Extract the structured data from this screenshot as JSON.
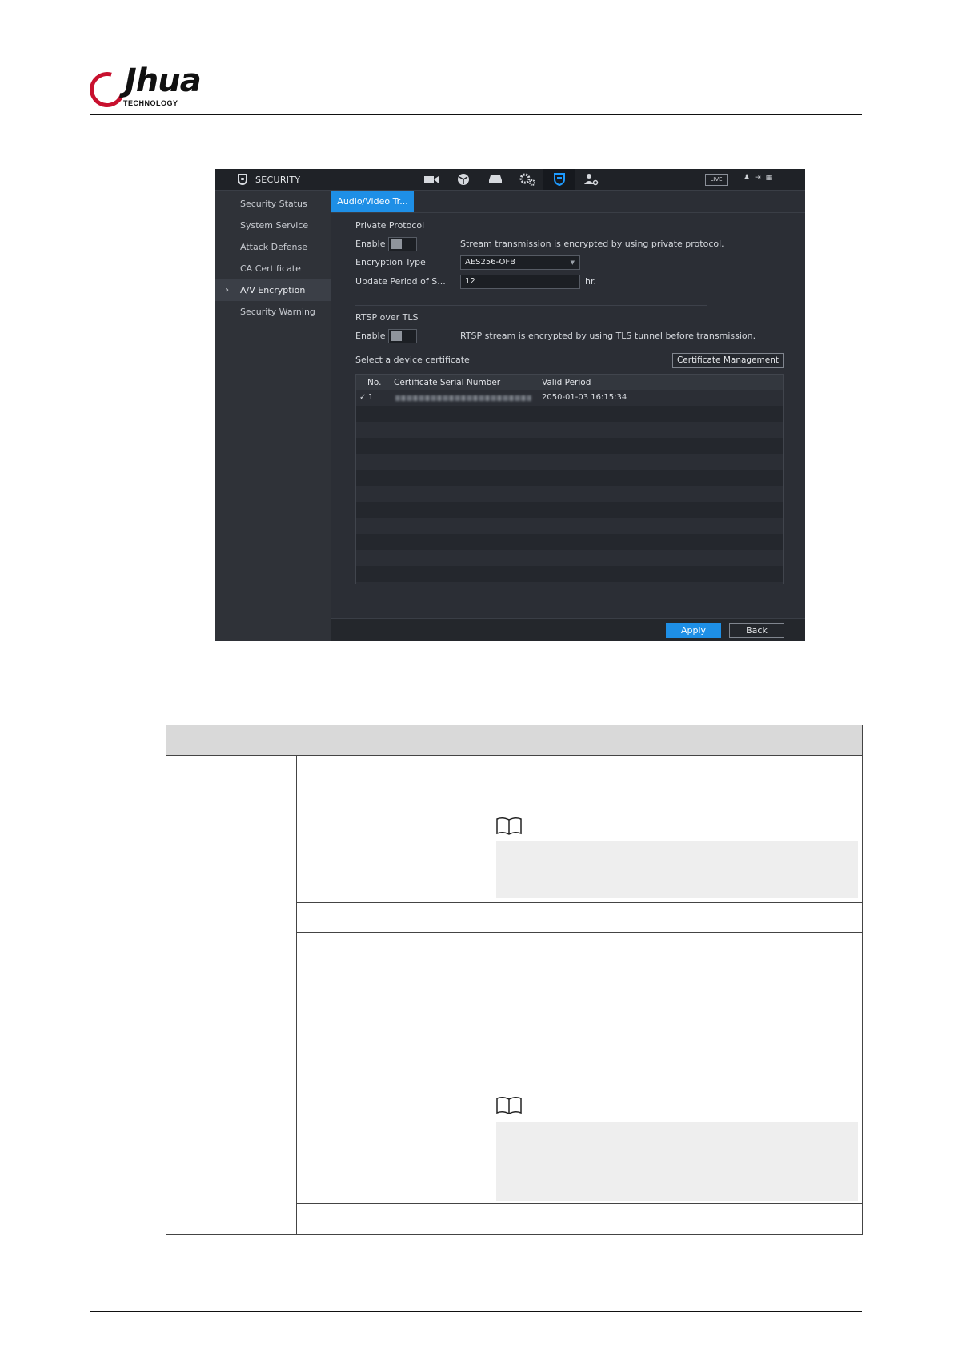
{
  "document": {
    "brand": "alhua",
    "brand_sub": "TECHNOLOGY"
  },
  "window": {
    "title": "SECURITY",
    "nav_icons": [
      "camera-icon",
      "network-icon",
      "storage-icon",
      "system-settings-icon",
      "security-shield-icon",
      "account-icon"
    ],
    "live_label": "LIVE",
    "sidebar": [
      {
        "label": "Security Status"
      },
      {
        "label": "System Service"
      },
      {
        "label": "Attack Defense"
      },
      {
        "label": "CA Certificate"
      },
      {
        "label": "A/V Encryption",
        "selected": true
      },
      {
        "label": "Security Warning"
      }
    ],
    "tab_label": "Audio/Video Tr...",
    "private_protocol": {
      "heading": "Private Protocol",
      "enable_label": "Enable",
      "enable_desc": "Stream transmission is encrypted by using private protocol.",
      "encryption_type_label": "Encryption Type",
      "encryption_type_value": "AES256-OFB",
      "update_period_label": "Update Period of S...",
      "update_period_value": "12",
      "update_period_unit": "hr."
    },
    "rtsp": {
      "heading": "RTSP over TLS",
      "enable_label": "Enable",
      "enable_desc": "RTSP stream is encrypted by using TLS tunnel before transmission.",
      "select_cert_label": "Select a device certificate",
      "cert_mgmt_button": "Certificate Management"
    },
    "cert_table": {
      "columns": [
        "No.",
        "Certificate Serial Number",
        "Valid Period"
      ],
      "rows": [
        {
          "check": "✓",
          "no": "1",
          "valid_period": "2050-01-03 16:15:34"
        }
      ]
    },
    "apply_button": "Apply",
    "back_button": "Back"
  },
  "colors": {
    "accent": "#1e8fe6",
    "brand_red": "#c8102e",
    "window_bg": "#2b2e35"
  }
}
